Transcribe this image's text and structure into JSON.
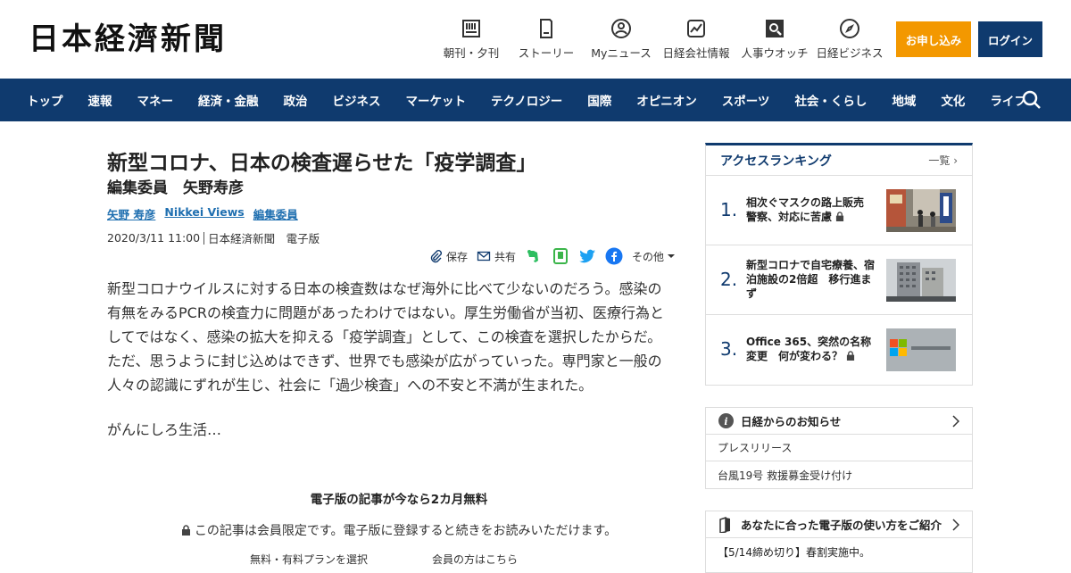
{
  "header": {
    "logo": "日本経濟新聞",
    "nav": [
      {
        "label": "朝刊・夕刊",
        "icon": "newspaper-icon"
      },
      {
        "label": "ストーリー",
        "icon": "book-icon"
      },
      {
        "label": "Myニュース",
        "icon": "user-icon"
      },
      {
        "label": "日経会社情報",
        "icon": "chart-icon"
      },
      {
        "label": "人事ウオッチ",
        "icon": "search-person-icon"
      },
      {
        "label": "日経ビジネス",
        "icon": "compass-icon"
      }
    ],
    "apply_label": "お申し込み",
    "login_label": "ログイン",
    "apply_color": "#f39800",
    "brand_color": "#0f3a6e"
  },
  "navbar": {
    "items": [
      "トップ",
      "速報",
      "マネー",
      "経済・金融",
      "政治",
      "ビジネス",
      "マーケット",
      "テクノロジー",
      "国際",
      "オピニオン",
      "スポーツ",
      "社会・くらし",
      "地域",
      "文化",
      "ライフ"
    ]
  },
  "article": {
    "title": "新型コロナ、日本の検査遅らせた「疫学調査」",
    "subtitle": "編集委員　矢野寿彦",
    "authors": [
      "矢野 寿彦",
      "Nikkei Views",
      "編集委員"
    ],
    "date": "2020/3/11 11:00",
    "source": "日本経済新聞　電子版",
    "share": {
      "save": "保存",
      "share": "共有",
      "more": "その他"
    },
    "body": "新型コロナウイルスに対する日本の検査数はなぜ海外に比べて少ないのだろう。感染の有無をみるPCRの検査力に問題があったわけではない。厚生労働省が当初、医療行為としてではなく、感染の拡大を抑える「疫学調査」として、この検査を選択したからだ。ただ、思うように封じ込めはできず、世界でも感染が広がっていった。専門家と一般の人々の認識にずれが生じ、社会に「過少検査」への不安と不満が生まれた。",
    "continued": "がんにしろ生活…",
    "promo": "電子版の記事が今なら2カ月無料",
    "members_only": "この記事は会員限定です。電子版に登録すると続きをお読みいただけます。",
    "plans_link": "無料・有料プランを選択",
    "members_link": "会員の方はこちら"
  },
  "ranking": {
    "title": "アクセスランキング",
    "all_label": "一覧",
    "items": [
      {
        "num": "1.",
        "text": "相次ぐマスクの路上販売　警察、対応に苦慮"
      },
      {
        "num": "2.",
        "text": "新型コロナで自宅療養、宿泊施設の2倍超　移行進まず"
      },
      {
        "num": "3.",
        "text": "Office 365、突然の名称変更　何が変わる？"
      }
    ]
  },
  "notice": {
    "title": "日経からのお知らせ",
    "items": [
      "プレスリリース",
      "台風19号 救援募金受け付け"
    ]
  },
  "guide": {
    "title": "あなたに合った電子版の使い方をご紹介",
    "item": "【5/14締め切り】春割実施中。"
  }
}
